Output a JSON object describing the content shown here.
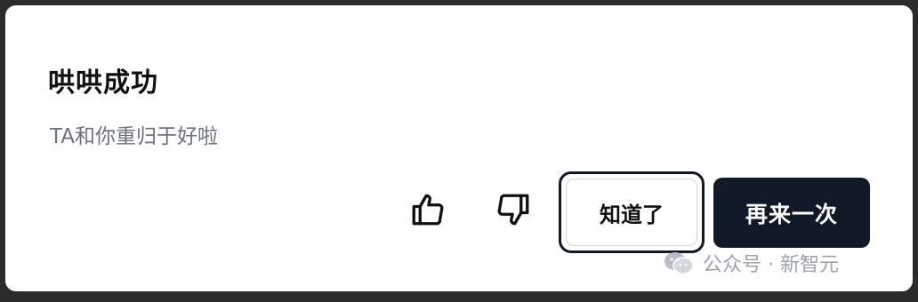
{
  "dialog": {
    "title": "哄哄成功",
    "message": "TA和你重归于好啦"
  },
  "actions": {
    "thumbs_up_icon": "thumbs-up-icon",
    "thumbs_down_icon": "thumbs-down-icon",
    "ack_label": "知道了",
    "retry_label": "再来一次"
  },
  "watermark": {
    "text": "公众号 · 新智元"
  },
  "colors": {
    "background": "#2b2b2b",
    "dialog": "#ffffff",
    "title": "#111111",
    "message": "#6b7280",
    "primary_button": "#111827",
    "primary_button_text": "#ffffff"
  }
}
